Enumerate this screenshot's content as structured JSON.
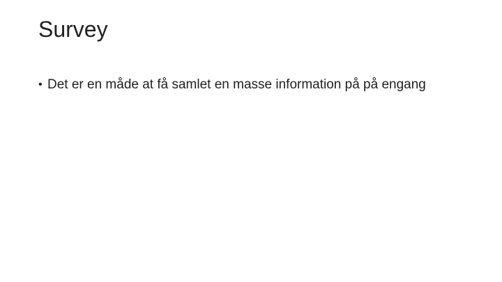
{
  "slide": {
    "title": "Survey",
    "bullets": [
      {
        "marker": "•",
        "text": "Det er en måde at få samlet en masse information på på engang"
      }
    ]
  }
}
